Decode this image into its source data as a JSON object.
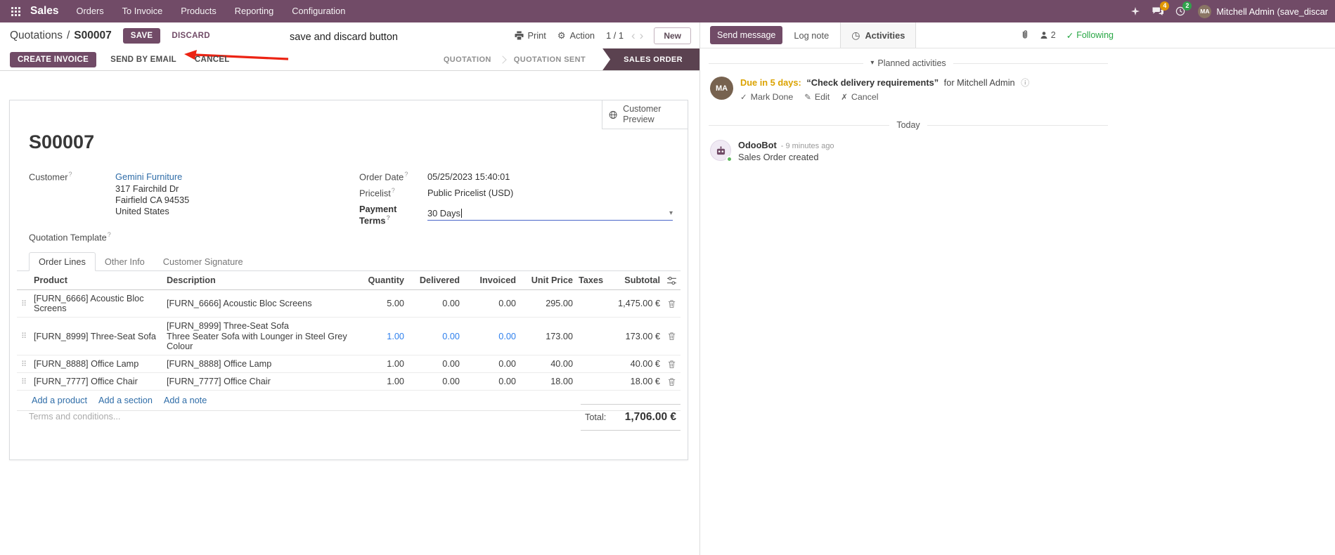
{
  "navbar": {
    "app_name": "Sales",
    "menus": [
      "Orders",
      "To Invoice",
      "Products",
      "Reporting",
      "Configuration"
    ],
    "messages_badge": "4",
    "activities_badge": "2",
    "user_name": "Mitchell Admin (save_discar",
    "avatar_initials": "MA"
  },
  "control_panel": {
    "breadcrumb_parent": "Quotations",
    "breadcrumb_divider": "/",
    "breadcrumb_current": "S00007",
    "save": "SAVE",
    "discard": "DISCARD",
    "print": "Print",
    "action": "Action",
    "pager": "1 / 1",
    "new": "New"
  },
  "annotation": {
    "label": "save and discard button"
  },
  "status_row": {
    "buttons": [
      "CREATE INVOICE",
      "SEND BY EMAIL",
      "CANCEL"
    ],
    "steps": [
      "QUOTATION",
      "QUOTATION SENT",
      "SALES ORDER"
    ]
  },
  "form": {
    "customer_preview": "Customer Preview",
    "title": "S00007",
    "labels": {
      "customer": "Customer",
      "quotation_template": "Quotation Template",
      "order_date": "Order Date",
      "pricelist": "Pricelist",
      "payment_terms": "Payment Terms"
    },
    "values": {
      "customer": "Gemini Furniture",
      "address_line1": "317 Fairchild Dr",
      "address_line2": "Fairfield CA 94535",
      "address_line3": "United States",
      "order_date": "05/25/2023 15:40:01",
      "pricelist": "Public Pricelist (USD)",
      "payment_terms": "30 Days"
    },
    "tabs": [
      "Order Lines",
      "Other Info",
      "Customer Signature"
    ],
    "table": {
      "columns": [
        "Product",
        "Description",
        "Quantity",
        "Delivered",
        "Invoiced",
        "Unit Price",
        "Taxes",
        "Subtotal"
      ],
      "rows": [
        {
          "product": "[FURN_6666] Acoustic Bloc Screens",
          "desc": "[FURN_6666] Acoustic Bloc Screens",
          "desc2": "",
          "qty": "5.00",
          "delivered": "0.00",
          "invoiced": "0.00",
          "price": "295.00",
          "subtotal": "1,475.00 €"
        },
        {
          "product": "[FURN_8999] Three-Seat Sofa",
          "desc": "[FURN_8999] Three-Seat Sofa",
          "desc2": "Three Seater Sofa with Lounger in Steel Grey Colour",
          "qty": "1.00",
          "delivered": "0.00",
          "invoiced": "0.00",
          "price": "173.00",
          "subtotal": "173.00 €"
        },
        {
          "product": "[FURN_8888] Office Lamp",
          "desc": "[FURN_8888] Office Lamp",
          "desc2": "",
          "qty": "1.00",
          "delivered": "0.00",
          "invoiced": "0.00",
          "price": "40.00",
          "subtotal": "40.00 €"
        },
        {
          "product": "[FURN_7777] Office Chair",
          "desc": "[FURN_7777] Office Chair",
          "desc2": "",
          "qty": "1.00",
          "delivered": "0.00",
          "invoiced": "0.00",
          "price": "18.00",
          "subtotal": "18.00 €"
        }
      ],
      "links": [
        "Add a product",
        "Add a section",
        "Add a note"
      ],
      "terms_placeholder": "Terms and conditions...",
      "total_label": "Total:",
      "total_value": "1,706.00 €"
    }
  },
  "chatter": {
    "send_message": "Send message",
    "log_note": "Log note",
    "activities": "Activities",
    "followers_count": "2",
    "following": "Following",
    "planned_header": "Planned activities",
    "avatar_initials": "MA",
    "activity": {
      "due": "Due in 5 days:",
      "summary": "“Check delivery requirements”",
      "for_text": "for Mitchell Admin",
      "mark_done": "Mark Done",
      "edit": "Edit",
      "cancel": "Cancel"
    },
    "today": "Today",
    "message": {
      "author": "OdooBot",
      "timestamp": "- 9 minutes ago",
      "body": "Sales Order created"
    }
  },
  "icons": {
    "gear": "⚙",
    "chevron_left": "‹",
    "chevron_right": "›",
    "caret_down": "▾",
    "drag_handle": "⠿",
    "check": "✓",
    "pencil": "✎",
    "cross": "✗",
    "info": "ⓘ",
    "clock": "◷",
    "help": "?"
  }
}
